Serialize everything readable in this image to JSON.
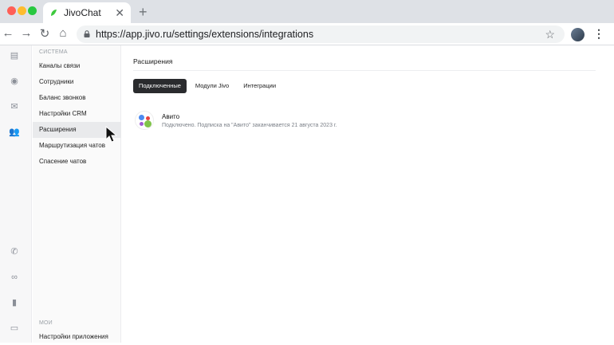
{
  "browser": {
    "tab_title": "JivoChat",
    "url": "https://app.jivo.ru/settings/extensions/integrations"
  },
  "sidebar": {
    "section_system": "СИСТЕМА",
    "items": [
      "Каналы связи",
      "Сотрудники",
      "Баланс звонков",
      "Настройки CRM",
      "Расширения",
      "Маршрутизация чатов",
      "Спасение чатов"
    ],
    "section_my": "МОИ",
    "my_items": [
      "Настройки приложения"
    ]
  },
  "main": {
    "title": "Расширения",
    "tabs": [
      "Подключенные",
      "Модули Jivo",
      "Интеграции"
    ],
    "extension": {
      "name": "Авито",
      "description": "Подключено. Подписка на \"Авито\" заканчивается 21 августа 2023 г."
    }
  }
}
